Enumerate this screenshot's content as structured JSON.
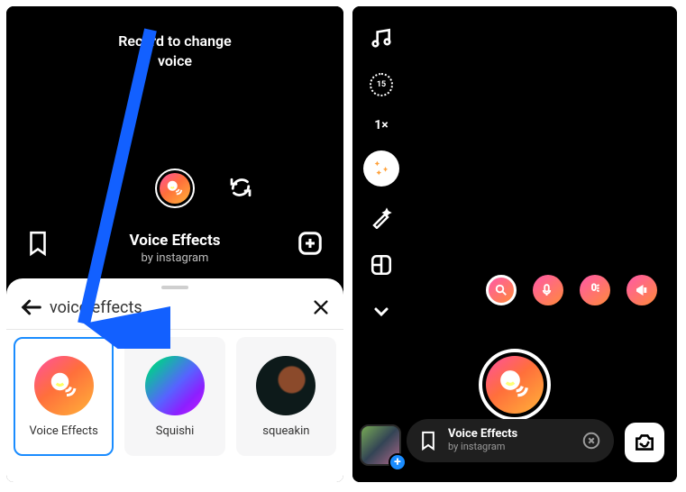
{
  "left": {
    "record_label_l1": "Record to change",
    "record_label_l2": "voice",
    "effect_title": "Voice Effects",
    "effect_sub": "by instagram",
    "search_value": "voice effects",
    "cards": [
      {
        "label": "Voice Effects"
      },
      {
        "label": "Squishi"
      },
      {
        "label": "squeakin"
      }
    ]
  },
  "right": {
    "timer": "15",
    "speed": "1×",
    "pill_title": "Voice Effects",
    "pill_sub": "by instagram"
  }
}
